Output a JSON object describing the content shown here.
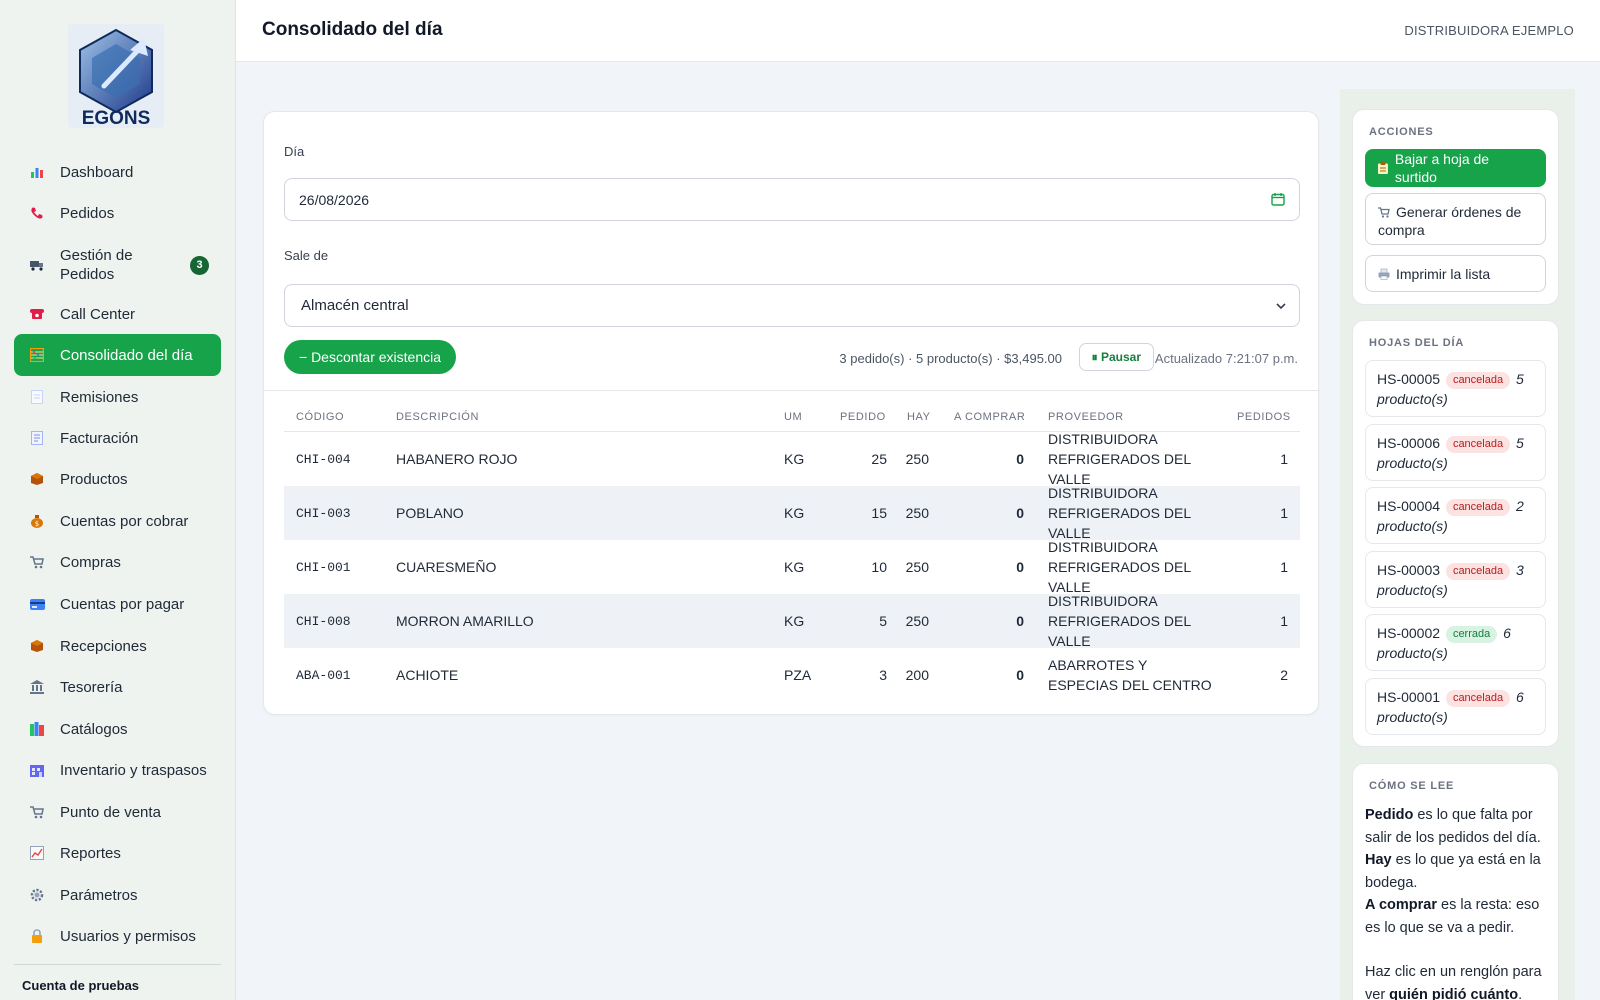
{
  "brand": {
    "name": "EGONS"
  },
  "sidebar": {
    "items": [
      {
        "label": "Dashboard",
        "icon": "chart-icon"
      },
      {
        "label": "Pedidos",
        "icon": "phone-icon"
      },
      {
        "label": "Gestión de Pedidos",
        "icon": "truck-icon",
        "badge": "3"
      },
      {
        "label": "Call Center",
        "icon": "telephone-icon"
      },
      {
        "label": "Consolidado del día",
        "icon": "abacus-icon",
        "active": true
      },
      {
        "label": "Remisiones",
        "icon": "document-icon"
      },
      {
        "label": "Facturación",
        "icon": "receipt-icon"
      },
      {
        "label": "Productos",
        "icon": "box-icon"
      },
      {
        "label": "Cuentas por cobrar",
        "icon": "money-bag-icon"
      },
      {
        "label": "Compras",
        "icon": "cart-icon"
      },
      {
        "label": "Cuentas por pagar",
        "icon": "card-icon"
      },
      {
        "label": "Recepciones",
        "icon": "package-icon"
      },
      {
        "label": "Tesorería",
        "icon": "bank-icon"
      },
      {
        "label": "Catálogos",
        "icon": "books-icon"
      },
      {
        "label": "Inventario y traspasos",
        "icon": "warehouse-icon"
      },
      {
        "label": "Punto de venta",
        "icon": "cart-icon"
      },
      {
        "label": "Reportes",
        "icon": "line-chart-icon"
      },
      {
        "label": "Parámetros",
        "icon": "gear-icon"
      },
      {
        "label": "Usuarios y permisos",
        "icon": "lock-icon"
      }
    ],
    "account": "Cuenta de pruebas"
  },
  "header": {
    "title": "Consolidado del día",
    "company": "DISTRIBUIDORA EJEMPLO"
  },
  "form": {
    "date_label": "Día",
    "date_value": "26/08/2026",
    "source_label": "Sale de",
    "source_value": "Almacén central",
    "discount_button": "− Descontar existencia",
    "summary": "3 pedido(s) · 5 producto(s) · $3,495.00",
    "pause_button": "⏸ Pausar",
    "updated": "Actualizado 7:21:07 p.m."
  },
  "table": {
    "headers": {
      "codigo": "CÓDIGO",
      "descripcion": "DESCRIPCIÓN",
      "um": "UM",
      "pedido": "PEDIDO",
      "hay": "HAY",
      "a_comprar": "A COMPRAR",
      "proveedor": "PROVEEDOR",
      "pedidos": "PEDIDOS"
    },
    "rows": [
      {
        "codigo": "CHI-004",
        "descripcion": "HABANERO ROJO",
        "um": "KG",
        "pedido": "25",
        "hay": "250",
        "a_comprar": "0",
        "proveedor": "DISTRIBUIDORA REFRIGERADOS DEL VALLE",
        "pedidos": "1"
      },
      {
        "codigo": "CHI-003",
        "descripcion": "POBLANO",
        "um": "KG",
        "pedido": "15",
        "hay": "250",
        "a_comprar": "0",
        "proveedor": "DISTRIBUIDORA REFRIGERADOS DEL VALLE",
        "pedidos": "1"
      },
      {
        "codigo": "CHI-001",
        "descripcion": "CUARESMEÑO",
        "um": "KG",
        "pedido": "10",
        "hay": "250",
        "a_comprar": "0",
        "proveedor": "DISTRIBUIDORA REFRIGERADOS DEL VALLE",
        "pedidos": "1"
      },
      {
        "codigo": "CHI-008",
        "descripcion": "MORRON AMARILLO",
        "um": "KG",
        "pedido": "5",
        "hay": "250",
        "a_comprar": "0",
        "proveedor": "DISTRIBUIDORA REFRIGERADOS DEL VALLE",
        "pedidos": "1"
      },
      {
        "codigo": "ABA-001",
        "descripcion": "ACHIOTE",
        "um": "PZA",
        "pedido": "3",
        "hay": "200",
        "a_comprar": "0",
        "proveedor": "ABARROTES Y ESPECIAS DEL CENTRO",
        "pedidos": "2"
      }
    ]
  },
  "actions": {
    "title": "ACCIONES",
    "buttons": [
      {
        "label": "Bajar a hoja de surtido",
        "icon": "clipboard-icon"
      },
      {
        "label": "Generar órdenes de compra",
        "icon": "cart-icon"
      },
      {
        "label": "Imprimir la lista",
        "icon": "printer-icon"
      }
    ]
  },
  "sheets": {
    "title": "HOJAS DEL DÍA",
    "items": [
      {
        "id": "HS-00005",
        "status": "cancelada",
        "count": "5 producto(s)"
      },
      {
        "id": "HS-00006",
        "status": "cancelada",
        "count": "5 producto(s)"
      },
      {
        "id": "HS-00004",
        "status": "cancelada",
        "count": "2 producto(s)"
      },
      {
        "id": "HS-00003",
        "status": "cancelada",
        "count": "3 producto(s)"
      },
      {
        "id": "HS-00002",
        "status": "cerrada",
        "count": "6 producto(s)"
      },
      {
        "id": "HS-00001",
        "status": "cancelada",
        "count": "6 producto(s)"
      }
    ]
  },
  "howto": {
    "title": "CÓMO SE LEE",
    "p1_term": "Pedido",
    "p1_text": " es lo que falta por salir de los pedidos del día.",
    "p2_term": "Hay",
    "p2_text": " es lo que ya está en la bodega.",
    "p3_term": "A comprar",
    "p3_text": " es la resta: eso es lo que se va a pedir.",
    "p4_text": "Haz clic en un renglón para ver ",
    "p4_term": "quién pidió cuánto",
    "p4_end": "."
  },
  "colors": {
    "accent": "#17a34a",
    "badge": "#166534",
    "cancel_bg": "#fde2e2",
    "cancel_fg": "#b91c1c",
    "closed_bg": "#d8f3e1",
    "closed_fg": "#15803d"
  }
}
